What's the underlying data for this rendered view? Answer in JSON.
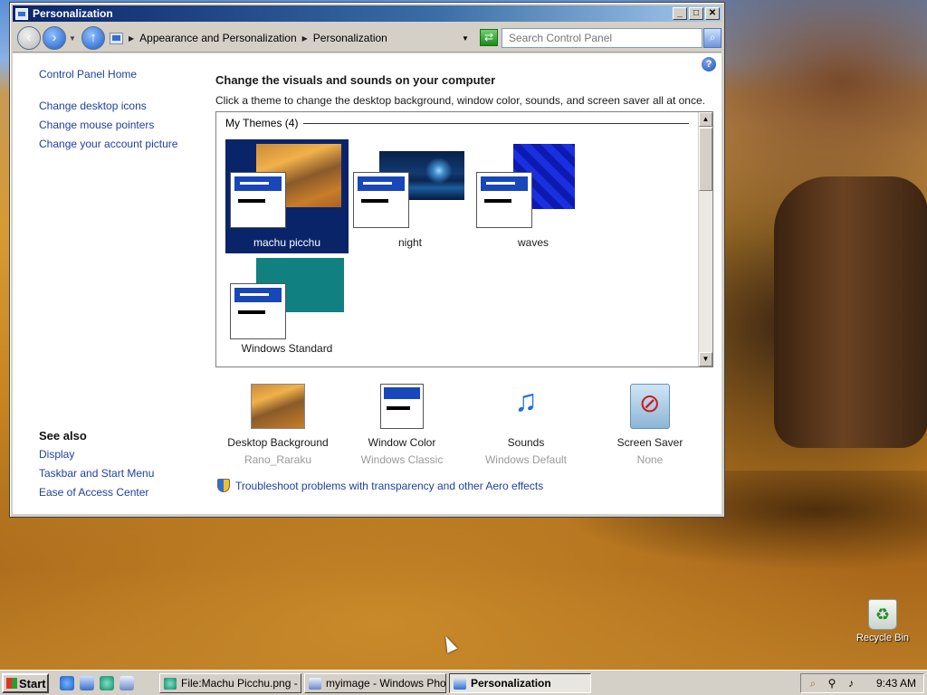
{
  "window": {
    "title": "Personalization",
    "controls": {
      "minimize": "_",
      "maximize": "□",
      "close": "✕"
    }
  },
  "addressbar": {
    "breadcrumb": [
      "Appearance and Personalization",
      "Personalization"
    ],
    "search_placeholder": "Search Control Panel"
  },
  "sidebar": {
    "home": "Control Panel Home",
    "tasks": [
      "Change desktop icons",
      "Change mouse pointers",
      "Change your account picture"
    ],
    "see_also_title": "See also",
    "see_also": [
      "Display",
      "Taskbar and Start Menu",
      "Ease of Access Center"
    ]
  },
  "main": {
    "title": "Change the visuals and sounds on your computer",
    "description": "Click a theme to change the desktop background, window color, sounds, and screen saver all at once.",
    "group_header": "My Themes (4)",
    "themes": [
      {
        "name": "machu picchu",
        "selected": true,
        "preview": "photo-rano-raraku"
      },
      {
        "name": "night",
        "selected": false,
        "preview": "night-sky"
      },
      {
        "name": "waves",
        "selected": false,
        "preview": "blue-pattern"
      },
      {
        "name": "Windows Standard",
        "selected": false,
        "preview": "teal-solid"
      }
    ],
    "settings": [
      {
        "name": "Desktop Background",
        "value": "Rano_Raraku",
        "icon": "desktop-background-icon"
      },
      {
        "name": "Window Color",
        "value": "Windows Classic",
        "icon": "window-color-icon"
      },
      {
        "name": "Sounds",
        "value": "Windows Default",
        "icon": "sounds-icon"
      },
      {
        "name": "Screen Saver",
        "value": "None",
        "icon": "screen-saver-icon"
      }
    ],
    "troubleshoot_link": "Troubleshoot problems with transparency and other Aero effects"
  },
  "desktop": {
    "icons": [
      {
        "label": "Recycle Bin"
      }
    ]
  },
  "taskbar": {
    "start_label": "Start",
    "tasks": [
      {
        "label": "File:Machu Picchu.png - ...",
        "active": false
      },
      {
        "label": "myimage - Windows Phot...",
        "active": false
      },
      {
        "label": "Personalization",
        "active": true
      }
    ],
    "clock": "9:43 AM"
  },
  "colors": {
    "selection": "#0a246a",
    "link": "#1f3f9e",
    "titlebar_start": "#0a246a",
    "titlebar_end": "#a6caf0"
  }
}
